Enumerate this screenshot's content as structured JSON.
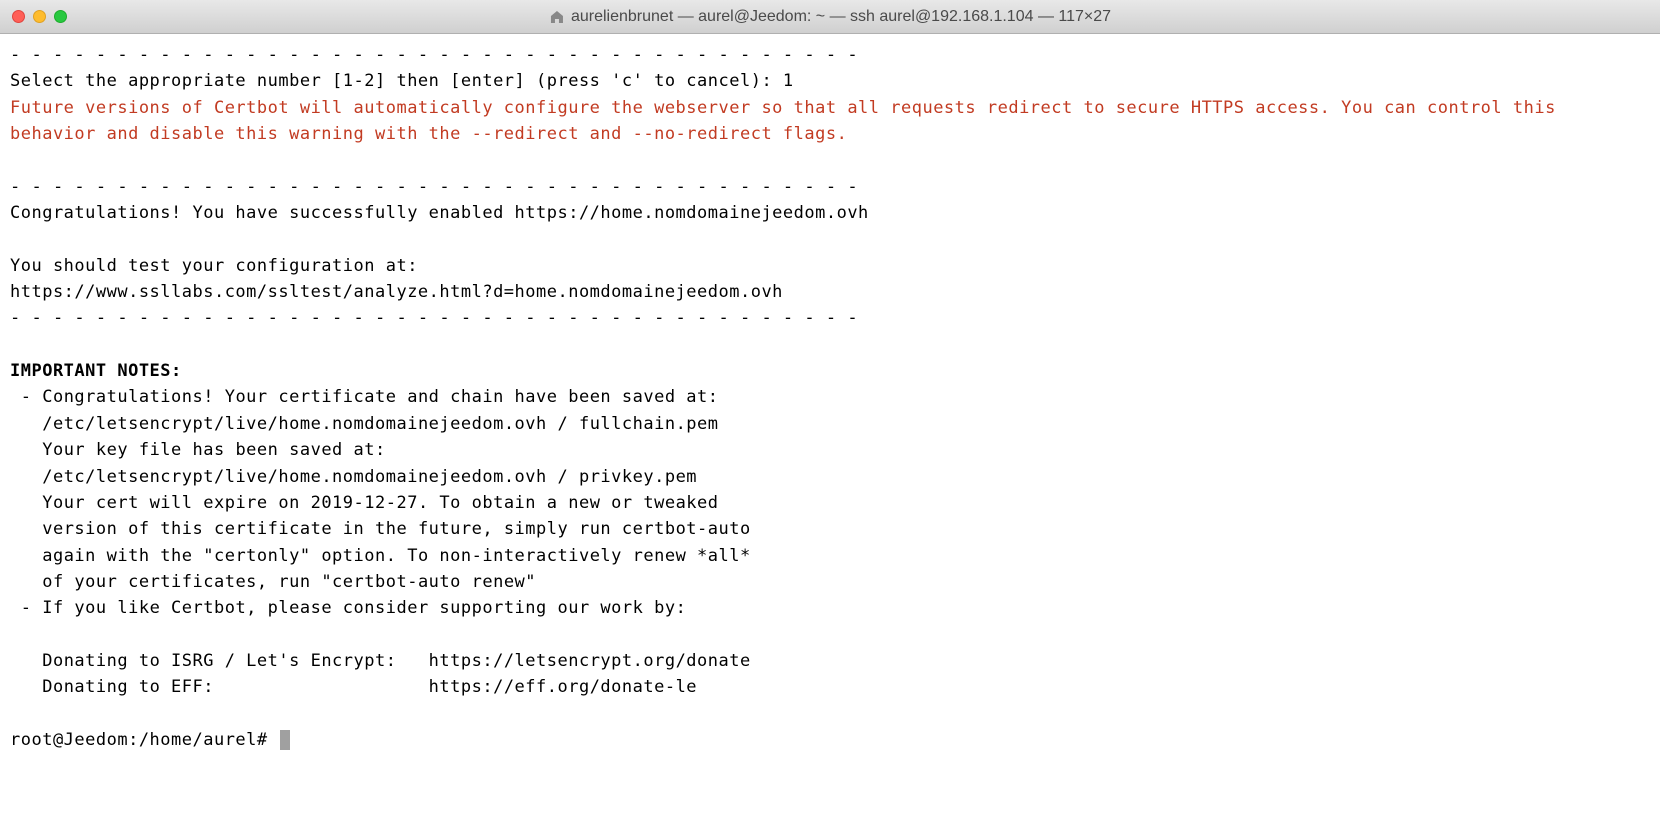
{
  "titlebar": {
    "title": "aurelienbrunet — aurel@Jeedom: ~ — ssh aurel@192.168.1.104 — 117×27"
  },
  "terminal": {
    "dashes1": "- - - - - - - - - - - - - - - - - - - - - - - - - - - - - - - - - - - - - - - -",
    "select_line": "Select the appropriate number [1-2] then [enter] (press 'c' to cancel): 1",
    "warning": "Future versions of Certbot will automatically configure the webserver so that all requests redirect to secure HTTPS access. You can control this behavior and disable this warning with the --redirect and --no-redirect flags.",
    "dashes2": "- - - - - - - - - - - - - - - - - - - - - - - - - - - - - - - - - - - - - - - -",
    "congrats": "Congratulations! You have successfully enabled https://home.nomdomainejeedom.ovh",
    "test_config": "You should test your configuration at:",
    "test_url": "https://www.ssllabs.com/ssltest/analyze.html?d=home.nomdomainejeedom.ovh",
    "dashes3": "- - - - - - - - - - - - - - - - - - - - - - - - - - - - - - - - - - - - - - - -",
    "important_header": "IMPORTANT NOTES:",
    "note1_line1": " - Congratulations! Your certificate and chain have been saved at:",
    "note1_line2": "   /etc/letsencrypt/live/home.nomdomainejeedom.ovh / fullchain.pem",
    "note1_line3": "   Your key file has been saved at:",
    "note1_line4": "   /etc/letsencrypt/live/home.nomdomainejeedom.ovh / privkey.pem",
    "note1_line5": "   Your cert will expire on 2019-12-27. To obtain a new or tweaked",
    "note1_line6": "   version of this certificate in the future, simply run certbot-auto",
    "note1_line7": "   again with the \"certonly\" option. To non-interactively renew *all*",
    "note1_line8": "   of your certificates, run \"certbot-auto renew\"",
    "note2_line1": " - If you like Certbot, please consider supporting our work by:",
    "donate1": "   Donating to ISRG / Let's Encrypt:   https://letsencrypt.org/donate",
    "donate2": "   Donating to EFF:                    https://eff.org/donate-le",
    "prompt": "root@Jeedom:/home/aurel# "
  }
}
